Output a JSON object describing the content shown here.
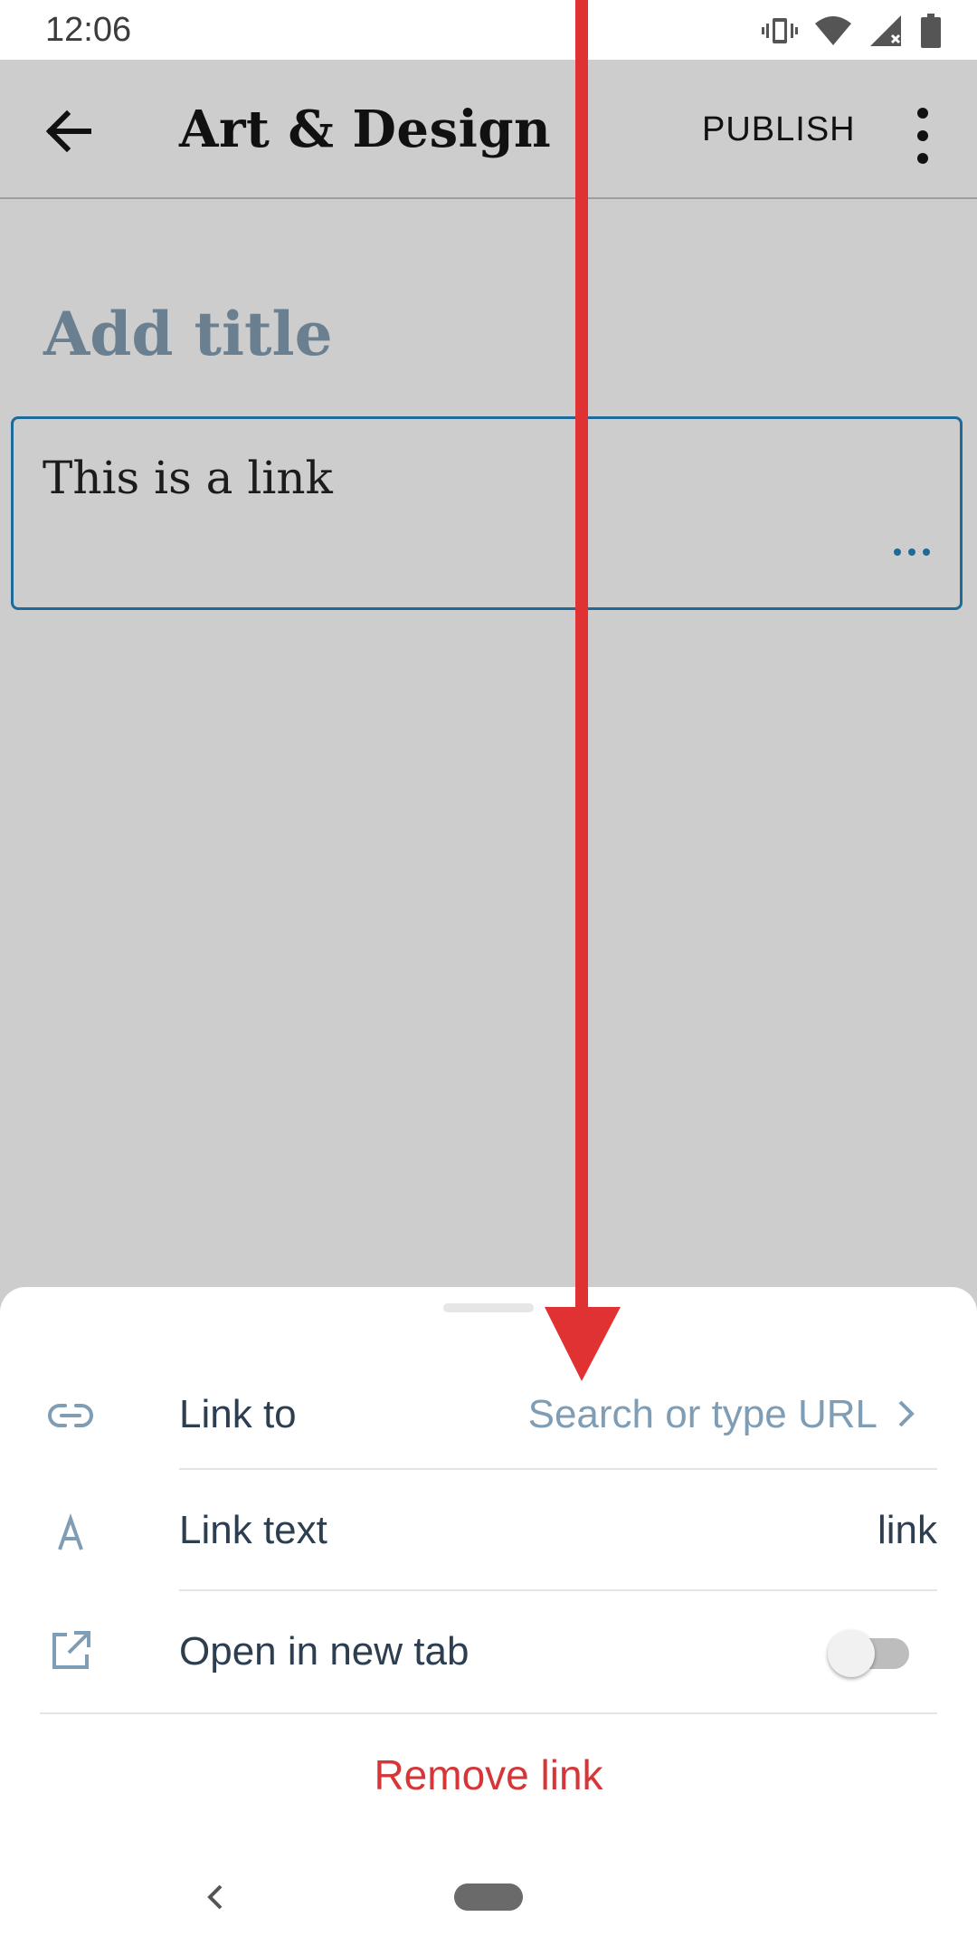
{
  "status_bar": {
    "time": "12:06",
    "icons": [
      "vibrate-icon",
      "wifi-icon",
      "signal-icon",
      "battery-icon"
    ]
  },
  "app_bar": {
    "back_icon": "arrow-left-icon",
    "title": "Art & Design",
    "publish_label": "PUBLISH",
    "more_icon": "more-vert-icon"
  },
  "editor": {
    "title_placeholder": "Add title",
    "paragraph_text": "This is a link",
    "block_more_icon": "ellipsis-icon"
  },
  "link_sheet": {
    "link_to": {
      "icon": "link-icon",
      "label": "Link to",
      "placeholder": "Search or type URL",
      "chevron_icon": "chevron-right-icon"
    },
    "link_text": {
      "icon": "text-a-icon",
      "label": "Link text",
      "value": "link"
    },
    "new_tab": {
      "icon": "external-link-icon",
      "label": "Open in new tab",
      "enabled": false
    },
    "remove_label": "Remove link"
  },
  "nav_bar": {
    "back_icon": "nav-back-icon",
    "home_icon": "nav-home-pill"
  },
  "colors": {
    "accent": "#1e6a98",
    "destructive": "#d63638",
    "placeholder": "#7f9db5",
    "overlay_arrow": "#e03232"
  }
}
